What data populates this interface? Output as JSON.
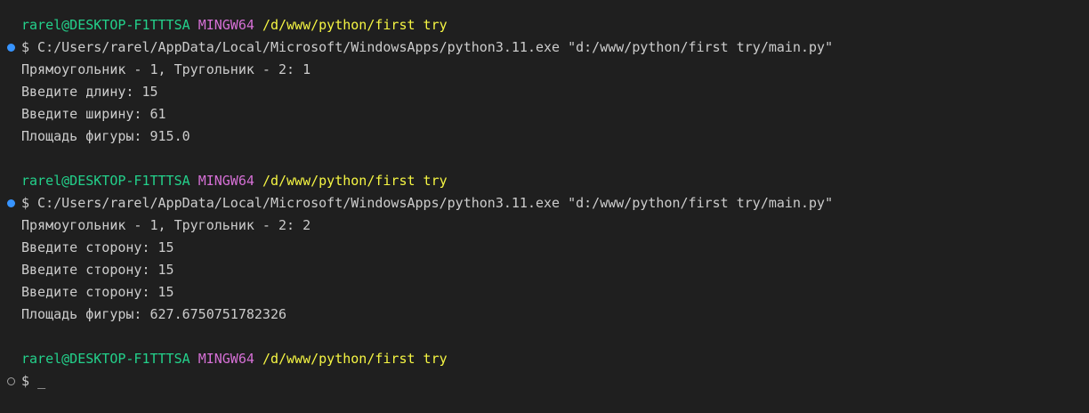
{
  "terminal": {
    "blocks": [
      {
        "prompt": {
          "user_host": "rarel@DESKTOP-F1TTTSA",
          "shell": "MINGW64",
          "cwd": "/d/www/python/first try"
        },
        "command": "$ C:/Users/rarel/AppData/Local/Microsoft/WindowsApps/python3.11.exe \"d:/www/python/first try/main.py\"",
        "output": [
          "Прямоугольник - 1, Тругольник - 2: 1",
          "Введите длину: 15",
          "Введите ширину: 61",
          "Площадь фигуры: 915.0"
        ]
      },
      {
        "prompt": {
          "user_host": "rarel@DESKTOP-F1TTTSA",
          "shell": "MINGW64",
          "cwd": "/d/www/python/first try"
        },
        "command": "$ C:/Users/rarel/AppData/Local/Microsoft/WindowsApps/python3.11.exe \"d:/www/python/first try/main.py\"",
        "output": [
          "Прямоугольник - 1, Тругольник - 2: 2",
          "Введите сторону: 15",
          "Введите сторону: 15",
          "Введите сторону: 15",
          "Площадь фигуры: 627.6750751782326"
        ]
      }
    ],
    "current": {
      "prompt": {
        "user_host": "rarel@DESKTOP-F1TTTSA",
        "shell": "MINGW64",
        "cwd": "/d/www/python/first try"
      },
      "input_prefix": "$ ",
      "cursor": "_"
    },
    "colors": {
      "background": "#1f1f1f",
      "text": "#cccccc",
      "user_host": "#23d18b",
      "shell": "#d670d6",
      "cwd": "#f5f543",
      "decoration_success": "#3794ff",
      "decoration_default": "#a0a0a0"
    }
  }
}
